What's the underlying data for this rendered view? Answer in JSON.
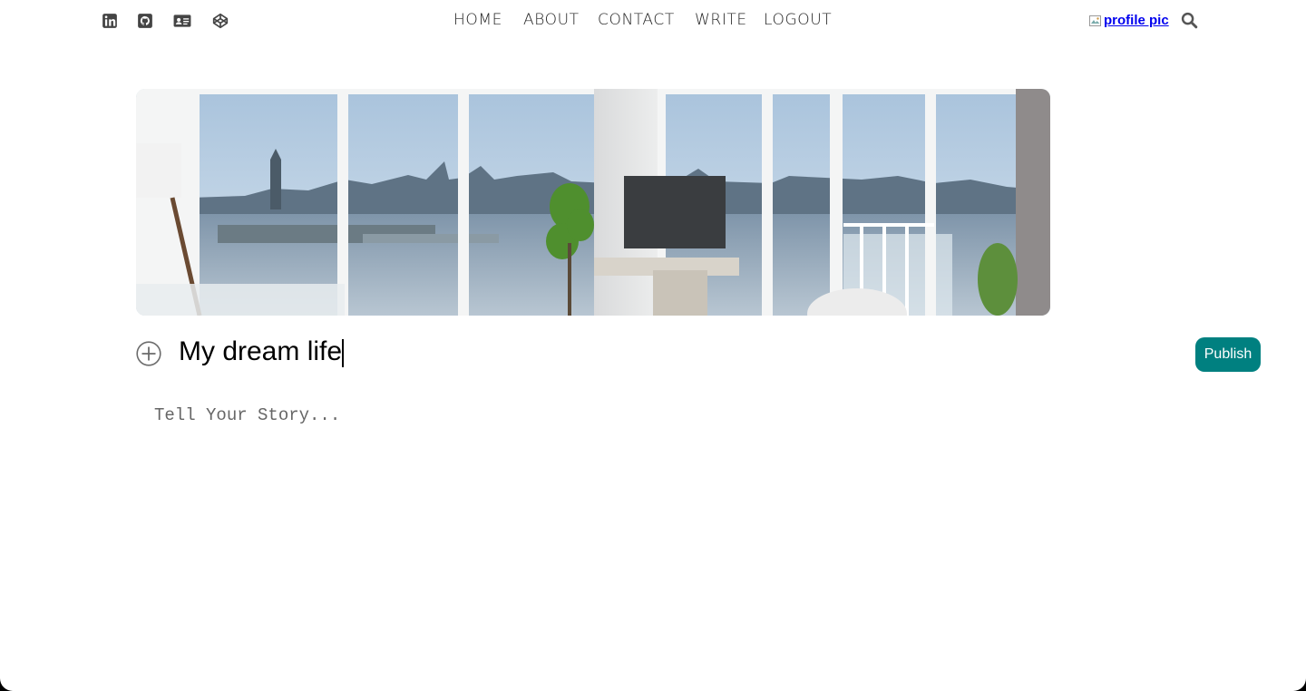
{
  "social_icons": [
    {
      "name": "linkedin-icon"
    },
    {
      "name": "github-icon"
    },
    {
      "name": "contact-card-icon"
    },
    {
      "name": "codepen-icon"
    }
  ],
  "nav": {
    "items": [
      "HOME",
      "ABOUT",
      "CONTACT",
      "WRITE",
      "LOGOUT"
    ]
  },
  "profile": {
    "alt_text": "profile pic"
  },
  "search": {
    "icon": "search-icon"
  },
  "hero": {
    "description_icon": "cover-image"
  },
  "editor": {
    "add_icon": "plus-circle-icon",
    "title_value": "My dream life",
    "story_placeholder": "Tell Your Story...",
    "story_value": "",
    "publish_label": "Publish"
  },
  "colors": {
    "accent": "#008080",
    "link": "#0000ee"
  }
}
